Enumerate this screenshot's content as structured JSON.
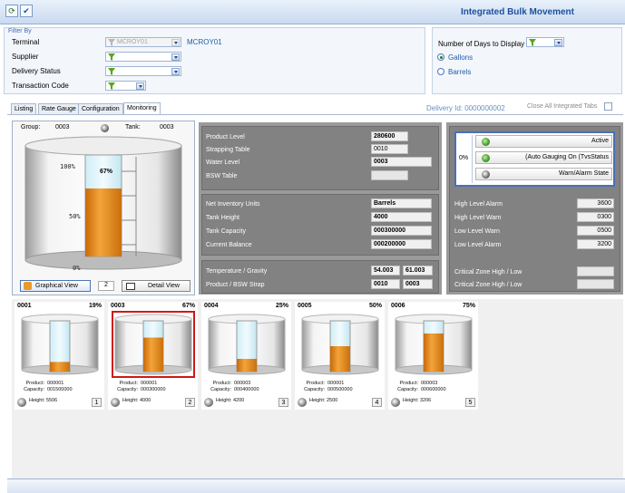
{
  "app": {
    "title": "Integrated Bulk Movement"
  },
  "filter": {
    "legend": "Filter By",
    "terminal_label": "Terminal",
    "terminal_value": "MCROY01",
    "terminal_text": "MCROY01",
    "supplier_label": "Supplier",
    "delivery_status_label": "Delivery Status",
    "transaction_code_label": "Transaction Code",
    "days_label": "Number of Days to Display",
    "gallons_label": "Gallons",
    "barrels_label": "Barrels",
    "selected_unit": "Gallons"
  },
  "tabs": [
    {
      "label": "Listing"
    },
    {
      "label": "Rate Gauge"
    },
    {
      "label": "Configuration"
    },
    {
      "label": "Monitoring",
      "active": true
    }
  ],
  "delivery_id": "Delivery Id: 0000000002",
  "close_all_label": "Close All Integrated Tabs",
  "tank_view": {
    "group_label": "Group:",
    "group_value": "0003",
    "tank_label": "Tank:",
    "tank_value": "0003",
    "scale_100": "100%",
    "scale_50": "50%",
    "scale_0": "0%",
    "fill_label": "67%",
    "fill_fraction": 0.67,
    "graphical_view_label": "Graphical View",
    "view_count": "2",
    "detail_view_label": "Detail View"
  },
  "levels": {
    "product_level_label": "Product Level",
    "product_level_value": "280600",
    "strapping_table_label": "Strapping Table",
    "strapping_table_value": "0010",
    "water_level_label": "Water Level",
    "water_level_value": "0003",
    "bsw_table_label": "BSW Table",
    "bsw_table_value": ""
  },
  "inventory": {
    "net_units_label": "Net Inventory Units",
    "net_units_value": "Barrels",
    "tank_height_label": "Tank Height",
    "tank_height_value": "4000",
    "tank_capacity_label": "Tank Capacity",
    "tank_capacity_value": "000300000",
    "current_balance_label": "Current Balance",
    "current_balance_value": "000200000"
  },
  "temperature": {
    "temp_label": "Temperature / Gravity",
    "temp_value": "54.003",
    "gravity_value": "61.003",
    "strap_label": "Product / BSW Strap",
    "product_strap_value": "0010",
    "bsw_strap_value": "0003"
  },
  "status": {
    "percent": "0%",
    "active_label": "Active",
    "auto_gauging_label": "(Auto Gauging On (TvsStatus",
    "warn_alarm_label": "Warn/Alarm State"
  },
  "alarms": {
    "high_level_alarm_label": "High Level Alarm",
    "high_level_alarm_value": "3600",
    "high_level_warn_label": "High Level Warn",
    "high_level_warn_value": "0300",
    "low_level_warn_label": "Low Level Warn",
    "low_level_warn_value": "0500",
    "low_level_alarm_label": "Low Level Alarm",
    "low_level_alarm_value": "3200",
    "critical_high_label": "Critical Zone High / Low",
    "critical_high_value": "",
    "critical_low_label": "Critical Zone High / Low",
    "critical_low_value": ""
  },
  "thumb_labels": {
    "product": "Product:",
    "capacity": "Capacity:",
    "height": "Height:"
  },
  "thumbnails": [
    {
      "tank": "0001",
      "percent": "19%",
      "fill": 0.19,
      "product": "000001",
      "capacity": "001500000",
      "height": "5506",
      "index": "1",
      "selected": false
    },
    {
      "tank": "0003",
      "percent": "67%",
      "fill": 0.67,
      "product": "000001",
      "capacity": "000300000",
      "height": "4000",
      "index": "2",
      "selected": true
    },
    {
      "tank": "0004",
      "percent": "25%",
      "fill": 0.25,
      "product": "000003",
      "capacity": "000400000",
      "height": "4200",
      "index": "3",
      "selected": false
    },
    {
      "tank": "0005",
      "percent": "50%",
      "fill": 0.5,
      "product": "000001",
      "capacity": "000500000",
      "height": "2500",
      "index": "4",
      "selected": false
    },
    {
      "tank": "0006",
      "percent": "75%",
      "fill": 0.75,
      "product": "000003",
      "capacity": "000600000",
      "height": "3206",
      "index": "5",
      "selected": false
    }
  ]
}
